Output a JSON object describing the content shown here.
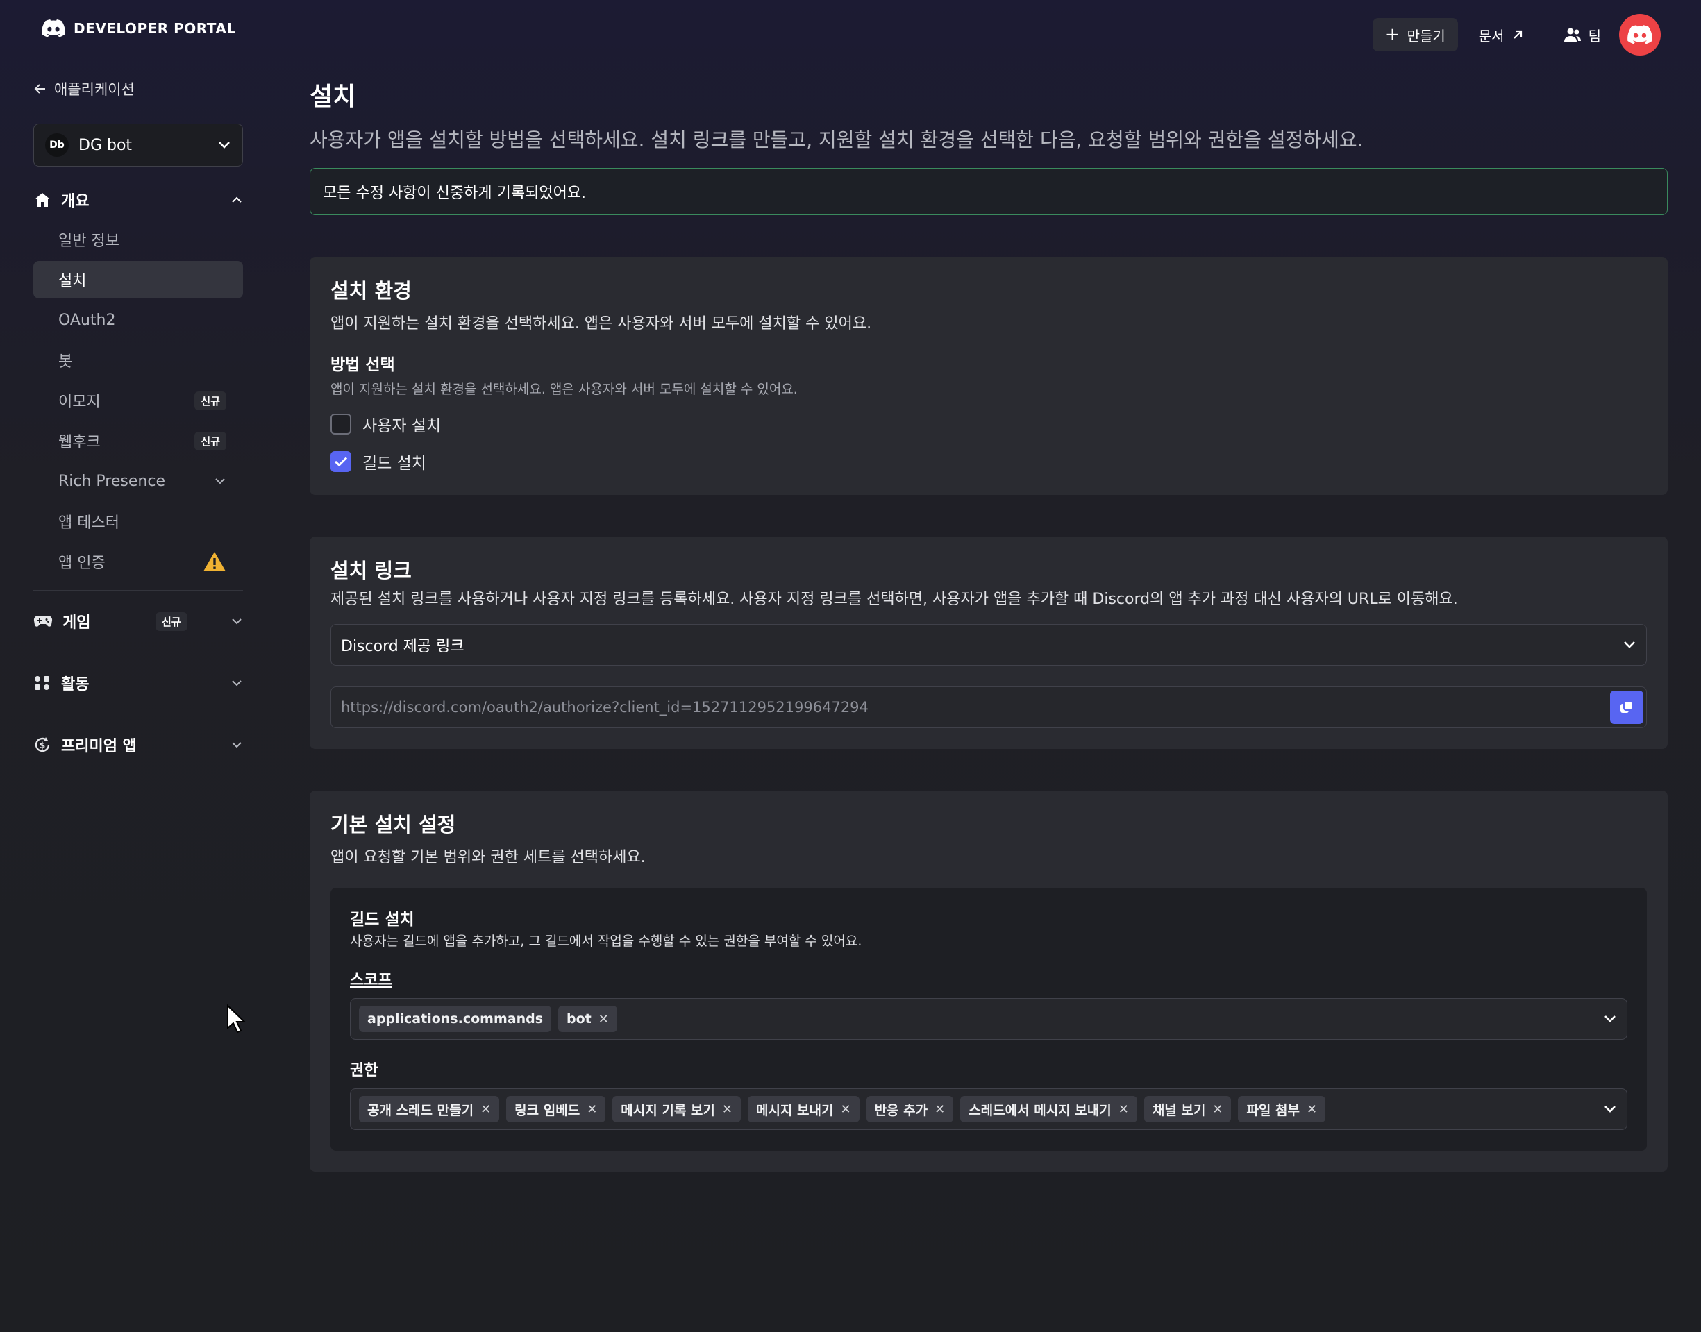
{
  "topbar": {
    "logo_text": "DEVELOPER PORTAL",
    "create_label": "만들기",
    "docs_label": "문서",
    "team_label": "팀"
  },
  "sidebar": {
    "back_label": "애플리케이션",
    "app": {
      "initials": "Db",
      "name": "DG bot"
    },
    "overview": {
      "label": "개요",
      "items": [
        {
          "label": "일반 정보"
        },
        {
          "label": "설치"
        },
        {
          "label": "OAuth2"
        },
        {
          "label": "봇"
        },
        {
          "label": "이모지",
          "badge": "신규"
        },
        {
          "label": "웹후크",
          "badge": "신규"
        },
        {
          "label": "Rich Presence"
        },
        {
          "label": "앱 테스터"
        },
        {
          "label": "앱 인증"
        }
      ]
    },
    "games": {
      "label": "게임",
      "badge": "신규"
    },
    "activities": {
      "label": "활동"
    },
    "premium": {
      "label": "프리미엄 앱"
    }
  },
  "main": {
    "title": "설치",
    "description": "사용자가 앱을 설치할 방법을 선택하세요. 설치 링크를 만들고, 지원할 설치 환경을 선택한 다음, 요청할 범위와 권한을 설정하세요.",
    "notice": "모든 수정 사항이 신중하게 기록되었어요.",
    "install_contexts": {
      "title": "설치 환경",
      "description": "앱이 지원하는 설치 환경을 선택하세요. 앱은 사용자와 서버 모두에 설치할 수 있어요.",
      "method_title": "방법 선택",
      "method_desc": "앱이 지원하는 설치 환경을 선택하세요. 앱은 사용자와 서버 모두에 설치할 수 있어요.",
      "user_install": {
        "label": "사용자 설치",
        "checked": false
      },
      "guild_install": {
        "label": "길드 설치",
        "checked": true
      }
    },
    "install_link": {
      "title": "설치 링크",
      "description": "제공된 설치 링크를 사용하거나 사용자 지정 링크를 등록하세요. 사용자 지정 링크를 선택하면, 사용자가 앱을 추가할 때 Discord의 앱 추가 과정 대신 사용자의 URL로 이동해요.",
      "selected": "Discord 제공 링크",
      "url": "https://discord.com/oauth2/authorize?client_id=1527112952199647294"
    },
    "default_settings": {
      "title": "기본 설치 설정",
      "description": "앱이 요청할 기본 범위와 권한 세트를 선택하세요.",
      "guild": {
        "title": "길드 설치",
        "description": "사용자는 길드에 앱을 추가하고, 그 길드에서 작업을 수행할 수 있는 권한을 부여할 수 있어요.",
        "scopes_label": "스코프",
        "scopes": [
          "applications.commands",
          "bot"
        ],
        "permissions_label": "권한",
        "permissions": [
          "공개 스레드 만들기",
          "링크 임베드",
          "메시지 기록 보기",
          "메시지 보내기",
          "반응 추가",
          "스레드에서 메시지 보내기",
          "채널 보기",
          "파일 첨부"
        ]
      }
    }
  },
  "colors": {
    "accent": "#5865f2",
    "avatar": "#ed4245",
    "warning": "#f0b232",
    "notice_border": "#3a8a5d"
  }
}
